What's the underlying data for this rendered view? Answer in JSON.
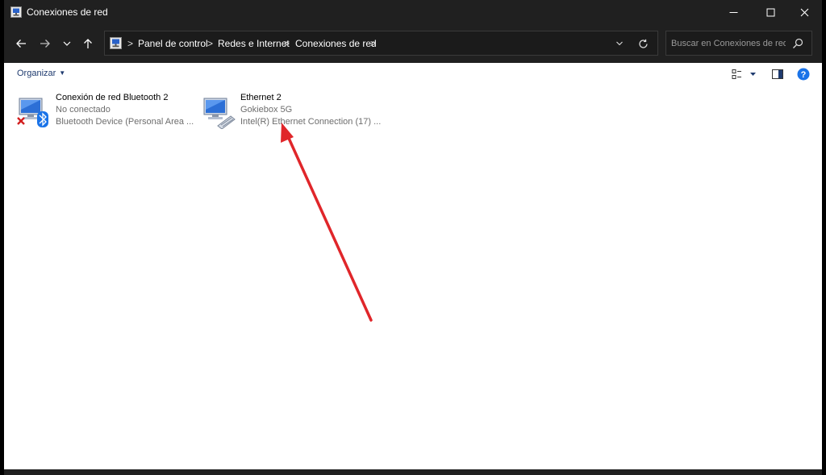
{
  "window": {
    "title": "Conexiones de red",
    "icon": "network-connections-icon"
  },
  "window_controls": {
    "minimize_icon": "minimize-icon",
    "maximize_icon": "maximize-icon",
    "close_icon": "close-icon"
  },
  "navigation": {
    "back_icon": "arrow-left-icon",
    "forward_icon": "arrow-right-icon",
    "recent_icon": "chevron-down-icon",
    "up_icon": "arrow-up-icon"
  },
  "address_bar": {
    "breadcrumbs": [
      "Panel de control",
      "Redes e Internet",
      "Conexiones de red"
    ],
    "separator": ">",
    "dropdown_icon": "chevron-down-icon",
    "refresh_icon": "refresh-icon"
  },
  "search": {
    "placeholder": "Buscar en Conexiones de red",
    "icon": "search-icon"
  },
  "command_bar": {
    "organize_label": "Organizar",
    "view_icon": "view-options-icon",
    "preview_pane_icon": "preview-pane-icon",
    "help_icon": "help-icon",
    "help_glyph": "?"
  },
  "connections": [
    {
      "name": "Conexión de red Bluetooth 2",
      "status": "No conectado",
      "device": "Bluetooth Device (Personal Area ...",
      "icon": "bluetooth-network-icon",
      "badge_icons": [
        "disconnected-x-icon",
        "bluetooth-icon"
      ]
    },
    {
      "name": "Ethernet 2",
      "status": "Gokiebox 5G",
      "device": "Intel(R) Ethernet Connection (17) ...",
      "icon": "ethernet-network-icon",
      "badge_icons": [
        "ethernet-cable-icon"
      ]
    }
  ],
  "annotation": {
    "type": "red-arrow",
    "color": "#e0262a"
  },
  "colors": {
    "titlebar": "#202020",
    "content_background": "#ffffff",
    "link_blue": "#1e3a6e",
    "help_blue": "#1a73e8",
    "accent_red": "#e0262a"
  }
}
